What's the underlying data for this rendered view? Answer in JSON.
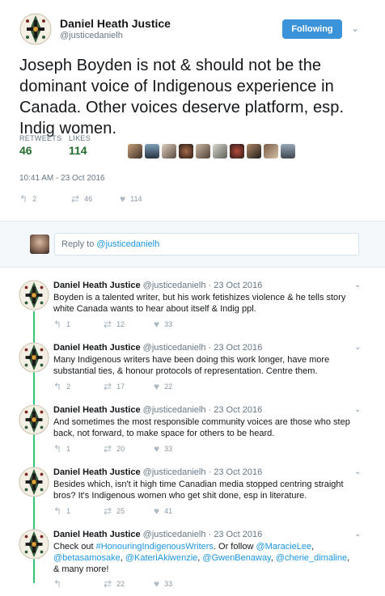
{
  "author": {
    "name": "Daniel Heath Justice",
    "handle": "@justicedanielh"
  },
  "follow_button_label": "Following",
  "tweet": {
    "text": "Joseph Boyden is not & should not be the dominant voice of Indigenous experience in Canada. Other voices deserve platform, esp. Indig women.",
    "retweets_label": "RETWEETS",
    "retweets": "46",
    "likes_label": "LIKES",
    "likes": "114",
    "timestamp": "10:41 AM - 23 Oct 2016",
    "reply_count": "2",
    "retweet_count": "46",
    "like_count": "114"
  },
  "reply_box": {
    "prefix": "Reply to ",
    "handle": "@justicedanielh"
  },
  "thread": [
    {
      "name": "Daniel Heath Justice",
      "meta": "@justicedanielh · 23 Oct 2016",
      "text": "Boyden is a talented writer, but his work fetishizes violence & he tells story white Canada wants to hear about itself & Indig ppl.",
      "replies": "1",
      "retweets": "12",
      "likes": "33"
    },
    {
      "name": "Daniel Heath Justice",
      "meta": "@justicedanielh · 23 Oct 2016",
      "text": "Many Indigenous writers have been doing this work longer, have more substantial ties, & honour protocols of representation. Centre them.",
      "replies": "2",
      "retweets": "17",
      "likes": "22"
    },
    {
      "name": "Daniel Heath Justice",
      "meta": "@justicedanielh · 23 Oct 2016",
      "text": "And sometimes the most responsible community voices are those who step back, not forward, to make space for others to be heard.",
      "replies": "1",
      "retweets": "20",
      "likes": "33"
    },
    {
      "name": "Daniel Heath Justice",
      "meta": "@justicedanielh · 23 Oct 2016",
      "text": "Besides which, isn't it high time Canadian media stopped centring straight bros? It's Indigenous women who get shit done, esp in literature.",
      "replies": "1",
      "retweets": "25",
      "likes": "41"
    },
    {
      "name": "Daniel Heath Justice",
      "meta": "@justicedanielh · 23 Oct 2016",
      "text_pre": "Check out ",
      "hashtag": "#HonouringIndigenousWriters",
      "text_mid": ". Or follow ",
      "m1": "@MaracieLee",
      "m2": "@betasamosake",
      "m3": "@KateriAkiwenzie",
      "m4": "@GwenBenaway",
      "m5": "@cherie_dimaline",
      "text_post": ", & many more!",
      "replies": "",
      "retweets": "22",
      "likes": "33"
    }
  ],
  "colors": {
    "follow_bg": "#3b94d9",
    "stat_value": "#246b2e",
    "link": "#1b95e0",
    "thread_line": "#39c478"
  }
}
